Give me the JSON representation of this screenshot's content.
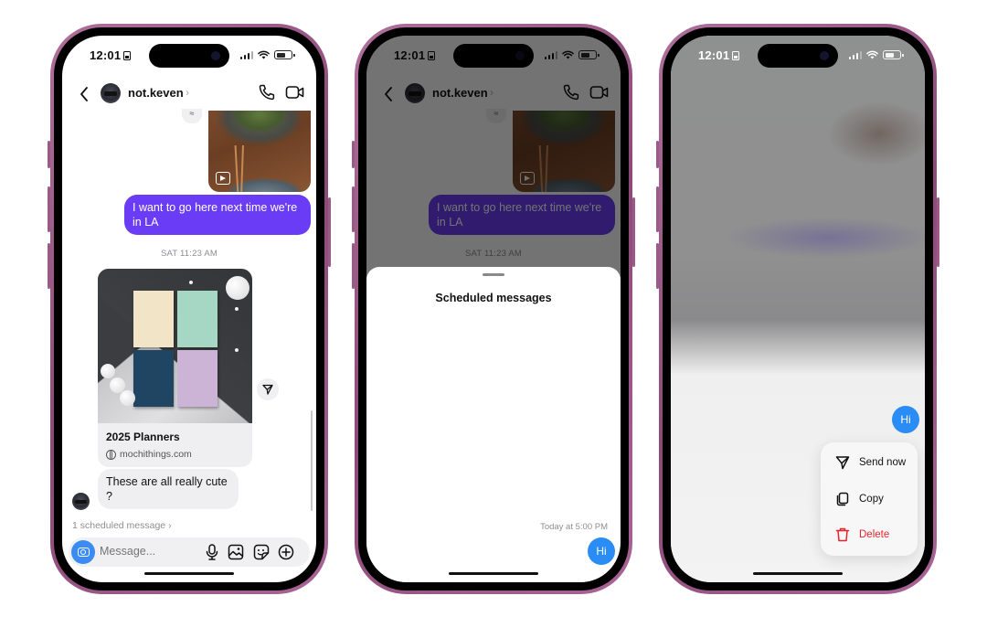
{
  "status_bar": {
    "time": "12:01"
  },
  "colors": {
    "outgoing_bubble": "#6a3cf5",
    "scheduled_bubble": "#2a8cf5",
    "camera_button": "#3a8bf2",
    "danger": "#e5252b",
    "phone_frame": "#9a5a88"
  },
  "chat": {
    "username": "not.keven",
    "username_chevron": "›",
    "back_icon": "chevron-left-icon",
    "call_icon": "phone-icon",
    "video_icon": "video-camera-icon",
    "shared_media_icon": "reel-icon",
    "outgoing_message": "I want to go here next time we're in LA",
    "timestamp": "SAT 11:23 AM",
    "link_card": {
      "title": "2025 Planners",
      "domain": "mochithings.com"
    },
    "incoming_message": "These are all really cute ?",
    "scheduled_link": "1 scheduled message ›",
    "composer": {
      "placeholder": "Message...",
      "icons": [
        "camera-icon",
        "microphone-icon",
        "gallery-icon",
        "sticker-icon",
        "add-icon"
      ]
    }
  },
  "scheduled_sheet": {
    "title": "Scheduled messages",
    "items": [
      {
        "time": "Today at 5:00 PM",
        "text": "Hi"
      }
    ]
  },
  "context_menu": {
    "message": "Hi",
    "items": [
      {
        "label": "Send now",
        "icon": "send-icon"
      },
      {
        "label": "Copy",
        "icon": "copy-icon"
      },
      {
        "label": "Delete",
        "icon": "trash-icon",
        "destructive": true
      }
    ]
  }
}
